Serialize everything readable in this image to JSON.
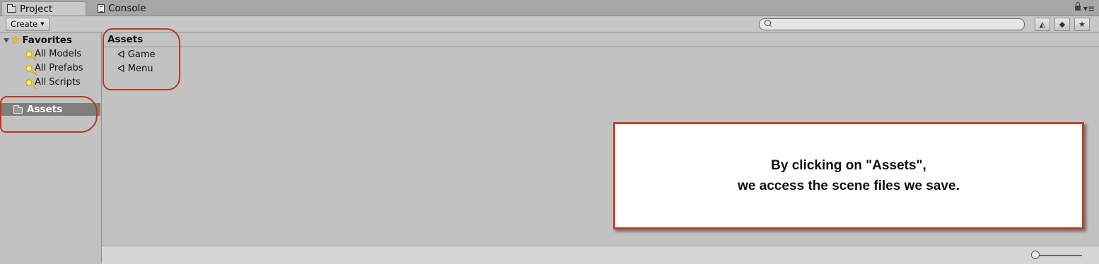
{
  "tabs": [
    {
      "label": "Project",
      "icon": "folder-icon",
      "active": true
    },
    {
      "label": "Console",
      "icon": "console-icon",
      "active": false
    }
  ],
  "toolbar": {
    "create_label": "Create",
    "search_placeholder": ""
  },
  "favorites": {
    "label": "Favorites",
    "items": [
      {
        "label": "All Models",
        "icon": "search-icon"
      },
      {
        "label": "All Prefabs",
        "icon": "search-icon"
      },
      {
        "label": "All Scripts",
        "icon": "search-icon"
      }
    ]
  },
  "folders": [
    {
      "label": "Assets",
      "icon": "folder-icon",
      "selected": true
    }
  ],
  "main": {
    "path": "Assets",
    "items": [
      {
        "label": "Game",
        "icon": "unity-scene-icon"
      },
      {
        "label": "Menu",
        "icon": "unity-scene-icon"
      }
    ]
  },
  "callout": {
    "line1": "By clicking on \"Assets\",",
    "line2": "we access the scene files we save."
  },
  "colors": {
    "annotation": "#c0442a",
    "selection": "#7e7e7e",
    "panel": "#c2c2c2"
  }
}
